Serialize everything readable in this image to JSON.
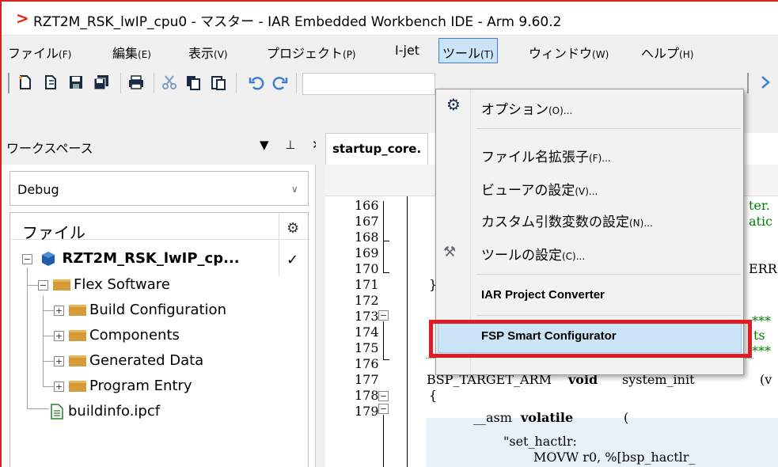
{
  "window": {
    "title": "RZT2M_RSK_lwIP_cpu0 - マスター - IAR Embedded Workbench IDE - Arm 9.60.2",
    "logo_glyph": ">"
  },
  "menubar": {
    "items": [
      {
        "label": "ファイル",
        "acc": "(F)"
      },
      {
        "label": "編集",
        "acc": "(E)"
      },
      {
        "label": "表示",
        "acc": "(V)"
      },
      {
        "label": "プロジェクト",
        "acc": "(P)"
      },
      {
        "label": "I-jet",
        "acc": ""
      },
      {
        "label": "ツール",
        "acc": "(T)"
      },
      {
        "label": "ウィンドウ",
        "acc": "(W)"
      },
      {
        "label": "ヘルプ",
        "acc": "(H)"
      }
    ]
  },
  "workspace": {
    "title": "ワークスペース",
    "header_buttons": "▼ ⊥ ✕",
    "config": "Debug",
    "tree_header": "ファイル",
    "tree": [
      {
        "label": "RZT2M_RSK_lwIP_cp...",
        "status": "✓"
      },
      {
        "label": "Flex Software"
      },
      {
        "label": "Build Configuration"
      },
      {
        "label": "Components"
      },
      {
        "label": "Generated Data"
      },
      {
        "label": "Program Entry"
      },
      {
        "label": "buildinfo.ipcf"
      }
    ]
  },
  "editor": {
    "tab_label": "startup_core.",
    "line_numbers": [
      "166",
      "167",
      "168",
      "169",
      "170",
      "171",
      "172",
      "173",
      "174",
      "175",
      "176",
      "177",
      "178",
      "179"
    ],
    "code_fragments": {
      "l166": "ter.",
      "l167": "atic",
      "l169": "ERR(",
      "l170": "}",
      "l172_star": "***",
      "l173": "ts",
      "l174": "***",
      "l175_a": "BSP_TARGET_ARM",
      "l175_b": "void",
      "l175_c": "system_init",
      "l175_d": "(v",
      "l176": "{",
      "l177_a": "__asm",
      "l177_b": "volatile",
      "l177_c": "(",
      "l178": "\"set_hactlr:",
      "l179": "MOVW  r0, %[bsp_hactlr_"
    }
  },
  "tools_menu": {
    "items": [
      {
        "label": "オプション",
        "acc": "(O)...",
        "icon": "gear-icon"
      },
      {
        "label": "ファイル名拡張子",
        "acc": "(F)..."
      },
      {
        "label": "ビューアの設定",
        "acc": "(V)..."
      },
      {
        "label": "カスタム引数変数の設定",
        "acc": "(N)..."
      },
      {
        "label": "ツールの設定",
        "acc": "(C)...",
        "icon": "tools-icon"
      },
      {
        "label": "IAR Project Converter",
        "acc": ""
      },
      {
        "label": "FSP Smart Configurator",
        "acc": ""
      }
    ]
  },
  "colors": {
    "highlight_box": "#e01b24",
    "menu_selected": "#cce4f7"
  }
}
